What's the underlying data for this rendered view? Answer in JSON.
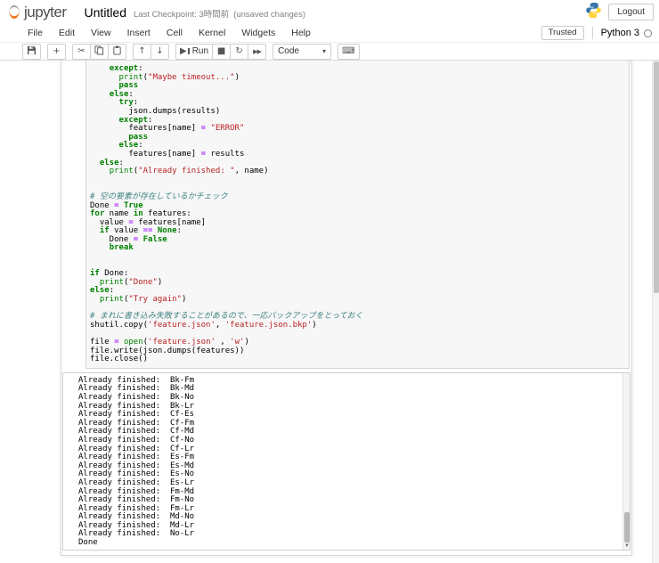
{
  "header": {
    "logo_text": "jupyter",
    "title": "Untitled",
    "checkpoint": "Last Checkpoint: 3時間前",
    "unsaved": "(unsaved changes)",
    "logout_label": "Logout"
  },
  "menubar": {
    "items": [
      "File",
      "Edit",
      "View",
      "Insert",
      "Cell",
      "Kernel",
      "Widgets",
      "Help"
    ],
    "trusted_label": "Trusted",
    "kernel_name": "Python 3"
  },
  "toolbar": {
    "icons": {
      "add": "+",
      "cut": "✂",
      "up": "↑",
      "down": "↓",
      "run": "▶",
      "stop": "■",
      "restart": "↻",
      "ff": "▶▶",
      "keyboard": "⌨",
      "dropdown": "▾"
    },
    "run_label": "Run",
    "cell_type_value": "Code"
  },
  "colors": {
    "accent_orange": "#f37726",
    "keyword": "#008000",
    "string": "#ba2121",
    "comment": "#408080",
    "operator": "#aa22ff"
  },
  "cell": {
    "code_lines": [
      [
        [
          "p",
          "    "
        ],
        [
          "k",
          "except"
        ],
        [
          "p",
          ":"
        ]
      ],
      [
        [
          "p",
          "      "
        ],
        [
          "b",
          "print"
        ],
        [
          "p",
          "("
        ],
        [
          "s",
          "\"Maybe timeout...\""
        ],
        [
          "p",
          ")"
        ]
      ],
      [
        [
          "p",
          "      "
        ],
        [
          "k",
          "pass"
        ]
      ],
      [
        [
          "p",
          "    "
        ],
        [
          "k",
          "else"
        ],
        [
          "p",
          ":"
        ]
      ],
      [
        [
          "p",
          "      "
        ],
        [
          "k",
          "try"
        ],
        [
          "p",
          ":"
        ]
      ],
      [
        [
          "p",
          "        json.dumps(results)"
        ]
      ],
      [
        [
          "p",
          "      "
        ],
        [
          "k",
          "except"
        ],
        [
          "p",
          ":"
        ]
      ],
      [
        [
          "p",
          "        features[name] "
        ],
        [
          "o",
          "="
        ],
        [
          "p",
          " "
        ],
        [
          "s",
          "\"ERROR\""
        ]
      ],
      [
        [
          "p",
          "        "
        ],
        [
          "k",
          "pass"
        ]
      ],
      [
        [
          "p",
          "      "
        ],
        [
          "k",
          "else"
        ],
        [
          "p",
          ":"
        ]
      ],
      [
        [
          "p",
          "        features[name] "
        ],
        [
          "o",
          "="
        ],
        [
          "p",
          " results"
        ]
      ],
      [
        [
          "p",
          "  "
        ],
        [
          "k",
          "else"
        ],
        [
          "p",
          ":"
        ]
      ],
      [
        [
          "p",
          "    "
        ],
        [
          "b",
          "print"
        ],
        [
          "p",
          "("
        ],
        [
          "s",
          "\"Already finished: \""
        ],
        [
          "p",
          ", name)"
        ]
      ],
      [],
      [],
      [
        [
          "c",
          "# 空の要素が存在しているかチェック"
        ]
      ],
      [
        [
          "p",
          "Done "
        ],
        [
          "o",
          "="
        ],
        [
          "p",
          " "
        ],
        [
          "k",
          "True"
        ]
      ],
      [
        [
          "k",
          "for"
        ],
        [
          "p",
          " name "
        ],
        [
          "k",
          "in"
        ],
        [
          "p",
          " features:"
        ]
      ],
      [
        [
          "p",
          "  value "
        ],
        [
          "o",
          "="
        ],
        [
          "p",
          " features[name]"
        ]
      ],
      [
        [
          "p",
          "  "
        ],
        [
          "k",
          "if"
        ],
        [
          "p",
          " value "
        ],
        [
          "o",
          "=="
        ],
        [
          "p",
          " "
        ],
        [
          "k",
          "None"
        ],
        [
          "p",
          ":"
        ]
      ],
      [
        [
          "p",
          "    Done "
        ],
        [
          "o",
          "="
        ],
        [
          "p",
          " "
        ],
        [
          "k",
          "False"
        ]
      ],
      [
        [
          "p",
          "    "
        ],
        [
          "k",
          "break"
        ]
      ],
      [],
      [],
      [
        [
          "k",
          "if"
        ],
        [
          "p",
          " Done:"
        ]
      ],
      [
        [
          "p",
          "  "
        ],
        [
          "b",
          "print"
        ],
        [
          "p",
          "("
        ],
        [
          "s",
          "\"Done\""
        ],
        [
          "p",
          ")"
        ]
      ],
      [
        [
          "k",
          "else"
        ],
        [
          "p",
          ":"
        ]
      ],
      [
        [
          "p",
          "  "
        ],
        [
          "b",
          "print"
        ],
        [
          "p",
          "("
        ],
        [
          "s",
          "\"Try again\""
        ],
        [
          "p",
          ")"
        ]
      ],
      [],
      [
        [
          "c",
          "# まれに書き込み失敗することがあるので、一応バックアップをとっておく"
        ]
      ],
      [
        [
          "p",
          "shutil.copy("
        ],
        [
          "s",
          "'feature.json'"
        ],
        [
          "p",
          ", "
        ],
        [
          "s",
          "'feature.json.bkp'"
        ],
        [
          "p",
          ")"
        ]
      ],
      [],
      [
        [
          "p",
          "file "
        ],
        [
          "o",
          "="
        ],
        [
          "p",
          " "
        ],
        [
          "b",
          "open"
        ],
        [
          "p",
          "("
        ],
        [
          "s",
          "'feature.json'"
        ],
        [
          "p",
          " , "
        ],
        [
          "s",
          "'w'"
        ],
        [
          "p",
          ")"
        ]
      ],
      [
        [
          "p",
          "file.write(json.dumps(features))"
        ]
      ],
      [
        [
          "p",
          "file.close()"
        ]
      ]
    ]
  },
  "output": {
    "lines": [
      "Already finished:  Bk-Fm",
      "Already finished:  Bk-Md",
      "Already finished:  Bk-No",
      "Already finished:  Bk-Lr",
      "Already finished:  Cf-Es",
      "Already finished:  Cf-Fm",
      "Already finished:  Cf-Md",
      "Already finished:  Cf-No",
      "Already finished:  Cf-Lr",
      "Already finished:  Es-Fm",
      "Already finished:  Es-Md",
      "Already finished:  Es-No",
      "Already finished:  Es-Lr",
      "Already finished:  Fm-Md",
      "Already finished:  Fm-No",
      "Already finished:  Fm-Lr",
      "Already finished:  Md-No",
      "Already finished:  Md-Lr",
      "Already finished:  No-Lr",
      "Done"
    ]
  }
}
